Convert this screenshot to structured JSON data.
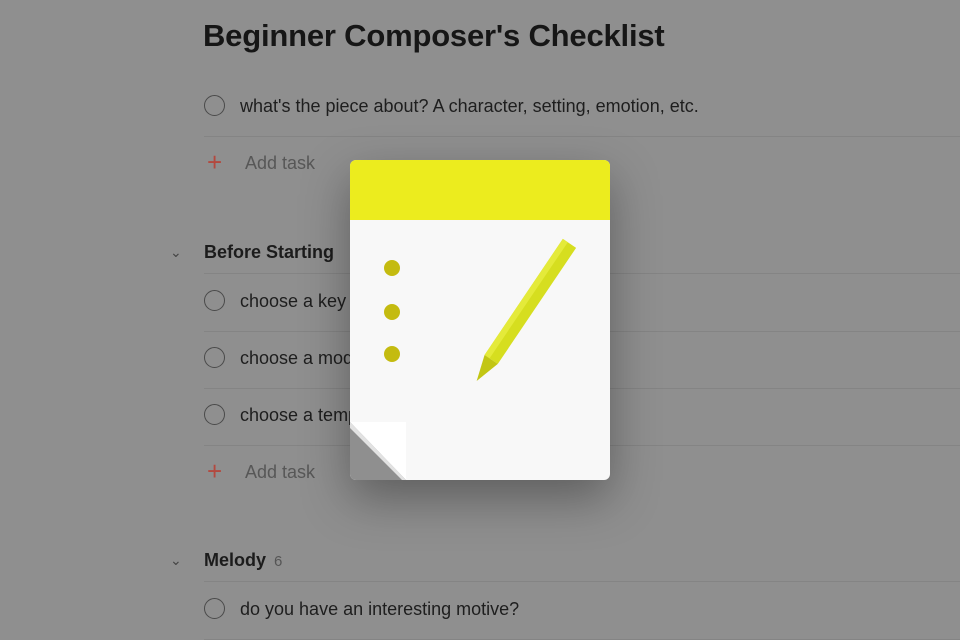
{
  "project": {
    "title": "Beginner Composer's Checklist"
  },
  "ungrouped": {
    "tasks": [
      "what's the piece about? A character, setting, emotion, etc."
    ],
    "add_task_label": "Add task"
  },
  "sections": [
    {
      "name": "Before Starting",
      "tasks": [
        "choose a key",
        "choose a mode",
        "choose a tempo"
      ],
      "add_task_label": "Add task"
    },
    {
      "name": "Melody",
      "count": "6",
      "tasks": [
        "do you have an interesting motive?"
      ]
    }
  ],
  "colors": {
    "overlay_bg": "#8f8f8f",
    "note_band": "#ecec1e",
    "note_dots": "#c4bb10",
    "pencil": "#d6de1f",
    "add_icon": "#b3493f"
  },
  "icons": {
    "loader": "notepad-pencil-icon",
    "section_toggle": "chevron-down-icon",
    "add": "plus-icon",
    "task_check": "circle-checkbox-icon"
  }
}
